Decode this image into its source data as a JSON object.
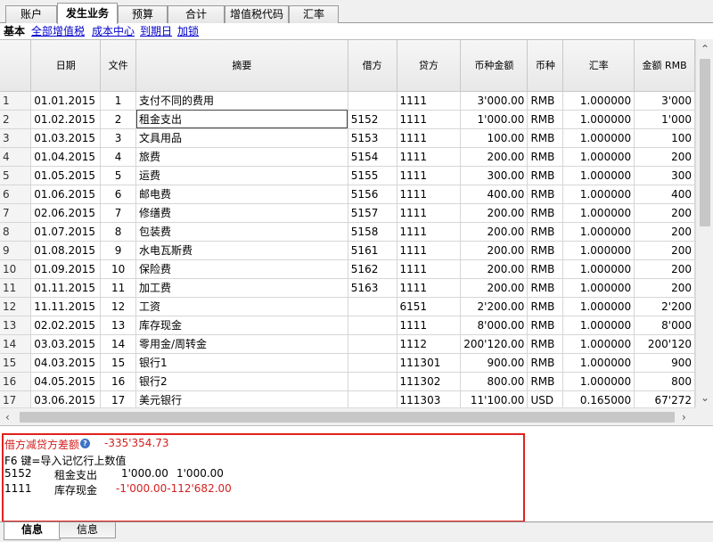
{
  "tabs": [
    "账户",
    "发生业务",
    "预算",
    "合计",
    "增值税代码",
    "汇率"
  ],
  "subtabs": [
    "基本",
    "全部增值税",
    "成本中心",
    "到期日",
    "加锁"
  ],
  "columns": [
    "日期",
    "文件",
    "摘要",
    "借方",
    "贷方",
    "币种金额",
    "币种",
    "汇率",
    "金额 RMB"
  ],
  "rows": [
    {
      "n": "1",
      "date": "01.01.2015",
      "doc": "1",
      "desc": "支付不同的费用",
      "debit": "",
      "credit": "1111",
      "amt": "3'000.00",
      "cur": "RMB",
      "rate": "1.000000",
      "rmb": "3'000"
    },
    {
      "n": "2",
      "date": "01.02.2015",
      "doc": "2",
      "desc": "租金支出",
      "debit": "5152",
      "credit": "1111",
      "amt": "1'000.00",
      "cur": "RMB",
      "rate": "1.000000",
      "rmb": "1'000"
    },
    {
      "n": "3",
      "date": "01.03.2015",
      "doc": "3",
      "desc": "文具用品",
      "debit": "5153",
      "credit": "1111",
      "amt": "100.00",
      "cur": "RMB",
      "rate": "1.000000",
      "rmb": "100"
    },
    {
      "n": "4",
      "date": "01.04.2015",
      "doc": "4",
      "desc": "旅费",
      "debit": "5154",
      "credit": "1111",
      "amt": "200.00",
      "cur": "RMB",
      "rate": "1.000000",
      "rmb": "200"
    },
    {
      "n": "5",
      "date": "01.05.2015",
      "doc": "5",
      "desc": "运费",
      "debit": "5155",
      "credit": "1111",
      "amt": "300.00",
      "cur": "RMB",
      "rate": "1.000000",
      "rmb": "300"
    },
    {
      "n": "6",
      "date": "01.06.2015",
      "doc": "6",
      "desc": "邮电费",
      "debit": "5156",
      "credit": "1111",
      "amt": "400.00",
      "cur": "RMB",
      "rate": "1.000000",
      "rmb": "400"
    },
    {
      "n": "7",
      "date": "02.06.2015",
      "doc": "7",
      "desc": "修缮费",
      "debit": "5157",
      "credit": "1111",
      "amt": "200.00",
      "cur": "RMB",
      "rate": "1.000000",
      "rmb": "200"
    },
    {
      "n": "8",
      "date": "01.07.2015",
      "doc": "8",
      "desc": "包装费",
      "debit": "5158",
      "credit": "1111",
      "amt": "200.00",
      "cur": "RMB",
      "rate": "1.000000",
      "rmb": "200"
    },
    {
      "n": "9",
      "date": "01.08.2015",
      "doc": "9",
      "desc": "水电瓦斯费",
      "debit": "5161",
      "credit": "1111",
      "amt": "200.00",
      "cur": "RMB",
      "rate": "1.000000",
      "rmb": "200"
    },
    {
      "n": "10",
      "date": "01.09.2015",
      "doc": "10",
      "desc": "保险费",
      "debit": "5162",
      "credit": "1111",
      "amt": "200.00",
      "cur": "RMB",
      "rate": "1.000000",
      "rmb": "200"
    },
    {
      "n": "11",
      "date": "01.11.2015",
      "doc": "11",
      "desc": "加工费",
      "debit": "5163",
      "credit": "1111",
      "amt": "200.00",
      "cur": "RMB",
      "rate": "1.000000",
      "rmb": "200"
    },
    {
      "n": "12",
      "date": "11.11.2015",
      "doc": "12",
      "desc": "工资",
      "debit": "",
      "credit": "6151",
      "amt": "2'200.00",
      "cur": "RMB",
      "rate": "1.000000",
      "rmb": "2'200"
    },
    {
      "n": "13",
      "date": "02.02.2015",
      "doc": "13",
      "desc": "库存现金",
      "debit": "",
      "credit": "1111",
      "amt": "8'000.00",
      "cur": "RMB",
      "rate": "1.000000",
      "rmb": "8'000"
    },
    {
      "n": "14",
      "date": "03.03.2015",
      "doc": "14",
      "desc": "零用金/周转金",
      "debit": "",
      "credit": "1112",
      "amt": "200'120.00",
      "cur": "RMB",
      "rate": "1.000000",
      "rmb": "200'120"
    },
    {
      "n": "15",
      "date": "04.03.2015",
      "doc": "15",
      "desc": "银行1",
      "debit": "",
      "credit": "111301",
      "amt": "900.00",
      "cur": "RMB",
      "rate": "1.000000",
      "rmb": "900"
    },
    {
      "n": "16",
      "date": "04.05.2015",
      "doc": "16",
      "desc": "银行2",
      "debit": "",
      "credit": "111302",
      "amt": "800.00",
      "cur": "RMB",
      "rate": "1.000000",
      "rmb": "800"
    },
    {
      "n": "17",
      "date": "03.06.2015",
      "doc": "17",
      "desc": "美元银行",
      "debit": "",
      "credit": "111303",
      "amt": "11'100.00",
      "cur": "USD",
      "rate": "0.165000",
      "rmb": "67'272"
    }
  ],
  "info": {
    "diff_label": "借方减贷方差额",
    "help_icon": "question-icon",
    "diff_value": "-335'354.73",
    "hint": "F6 键=导入记忆行上数值",
    "line1": {
      "acct": "5152",
      "name": "租金支出",
      "v1": "1'000.00",
      "v2": "1'000.00"
    },
    "line2": {
      "acct": "1111",
      "name": "库存现金",
      "v1": "-1'000.00",
      "v2": "-112'682.00"
    }
  },
  "bottom_tabs": [
    "信息",
    "信息"
  ],
  "colors": {
    "highlight_border": "#e0211d",
    "negative_text": "#d42020",
    "link": "#0000cc"
  }
}
